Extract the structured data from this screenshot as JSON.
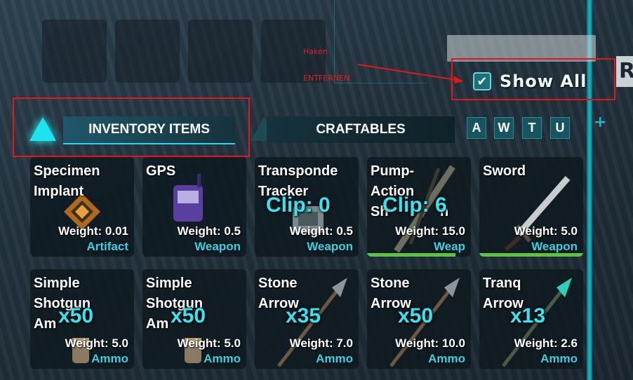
{
  "annotations": {
    "line1": "Haken",
    "line2": "ENTFERNEN"
  },
  "show_all": {
    "label": "Show All",
    "checked": true,
    "check_glyph": "✔"
  },
  "partial_button": {
    "label": "R"
  },
  "tabs": {
    "inventory": "INVENTORY ITEMS",
    "craftables": "CRAFTABLES"
  },
  "filters": [
    "A",
    "W",
    "T",
    "U"
  ],
  "plus_glyph": "+",
  "items": [
    {
      "name": "Specimen\nImplant",
      "weight": "Weight: 0.01",
      "type": "Artifact",
      "icon": "implant-icon"
    },
    {
      "name": "GPS",
      "weight": "Weight: 0.5",
      "type": "Weapon",
      "icon": "gps-icon"
    },
    {
      "name": "Transponde\nTracker",
      "weight": "Weight: 0.5",
      "type": "Weapon",
      "overlay": "Clip: 0",
      "icon": "tracker-icon"
    },
    {
      "name": "Pump-\nAction\nSh",
      "name_tail": "n",
      "weight": "Weight: 15.0",
      "type": "Weap",
      "overlay": "Clip: 6",
      "icon": "shotgun-icon",
      "durability": 0.85
    },
    {
      "name": "Sword",
      "weight": "Weight: 5.0",
      "type": "Weapon",
      "icon": "sword-icon",
      "durability": 1.0
    },
    {
      "name": "Simple\nShotgun\nAm",
      "weight": "Weight: 5.0",
      "type": "Ammo",
      "overlay": "x50",
      "icon": "shotgun-ammo-icon"
    },
    {
      "name": "Simple\nShotgun\nAm",
      "weight": "Weight: 5.0",
      "type": "Ammo",
      "overlay": "x50",
      "icon": "shotgun-ammo-icon"
    },
    {
      "name": "Stone\nArrow",
      "weight": "Weight: 7.0",
      "type": "Ammo",
      "overlay": "x35",
      "icon": "arrow-icon"
    },
    {
      "name": "Stone\nArrow",
      "weight": "Weight: 10.0",
      "type": "Ammo",
      "overlay": "x50",
      "icon": "arrow-icon"
    },
    {
      "name": "Tranq\nArrow",
      "weight": "Weight: 2.6",
      "type": "Ammo",
      "overlay": "x13",
      "icon": "tranq-arrow-icon"
    }
  ]
}
